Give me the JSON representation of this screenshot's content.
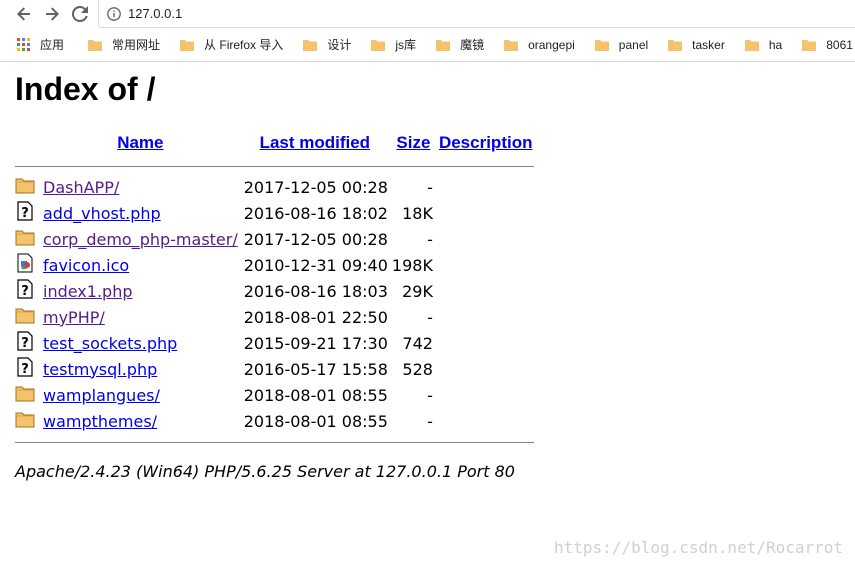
{
  "browser": {
    "url": "127.0.0.1",
    "apps_label": "应用",
    "bookmarks": [
      "常用网址",
      "从 Firefox 导入",
      "设计",
      "js库",
      "魔镜",
      "orangepi",
      "panel",
      "tasker",
      "ha",
      "8061"
    ]
  },
  "page": {
    "title": "Index of /",
    "columns": {
      "name": "Name",
      "modified": "Last modified",
      "size": "Size",
      "description": "Description"
    },
    "entries": [
      {
        "icon": "folder-icon",
        "name": "DashAPP/",
        "modified": "2017-12-05 00:28",
        "size": "-",
        "visited": true
      },
      {
        "icon": "unknown-file-icon",
        "name": "add_vhost.php",
        "modified": "2016-08-16 18:02",
        "size": "18K",
        "visited": false
      },
      {
        "icon": "folder-icon",
        "name": "corp_demo_php-master/",
        "modified": "2017-12-05 00:28",
        "size": "-",
        "visited": true
      },
      {
        "icon": "image-file-icon",
        "name": "favicon.ico",
        "modified": "2010-12-31 09:40",
        "size": "198K",
        "visited": false
      },
      {
        "icon": "unknown-file-icon",
        "name": "index1.php",
        "modified": "2016-08-16 18:03",
        "size": "29K",
        "visited": true
      },
      {
        "icon": "folder-icon",
        "name": "myPHP/",
        "modified": "2018-08-01 22:50",
        "size": "-",
        "visited": true
      },
      {
        "icon": "unknown-file-icon",
        "name": "test_sockets.php",
        "modified": "2015-09-21 17:30",
        "size": "742",
        "visited": false
      },
      {
        "icon": "unknown-file-icon",
        "name": "testmysql.php",
        "modified": "2016-05-17 15:58",
        "size": "528",
        "visited": false
      },
      {
        "icon": "folder-icon",
        "name": "wamplangues/",
        "modified": "2018-08-01 08:55",
        "size": "-",
        "visited": false
      },
      {
        "icon": "folder-icon",
        "name": "wampthemes/",
        "modified": "2018-08-01 08:55",
        "size": "-",
        "visited": false
      }
    ],
    "server_signature": "Apache/2.4.23 (Win64) PHP/5.6.25 Server at 127.0.0.1 Port 80",
    "watermark": "https://blog.csdn.net/Rocarrot"
  },
  "colors": {
    "link": "#0000ee",
    "visited_link": "#551a8b",
    "folder": "#f5c36b"
  }
}
